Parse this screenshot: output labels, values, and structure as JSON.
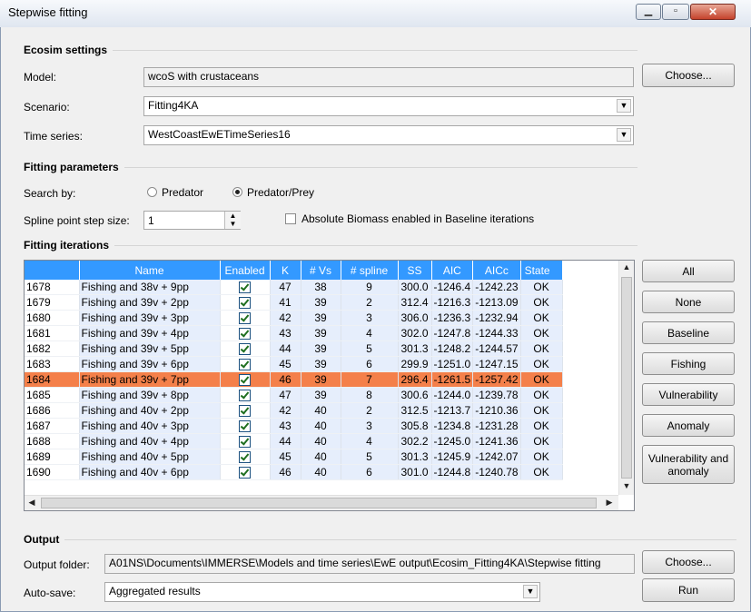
{
  "window": {
    "title": "Stepwise fitting"
  },
  "ecosim_settings": {
    "section_label": "Ecosim settings",
    "model_label": "Model:",
    "model_value": "wcoS with crustaceans",
    "choose_label": "Choose...",
    "scenario_label": "Scenario:",
    "scenario_value": "Fitting4KA",
    "time_series_label": "Time series:",
    "time_series_value": "WestCoastEwETimeSeries16"
  },
  "fitting_parameters": {
    "section_label": "Fitting parameters",
    "search_by_label": "Search by:",
    "predator_label": "Predator",
    "predator_prey_label": "Predator/Prey",
    "selected": "Predator/Prey",
    "spline_label": "Spline point step size:",
    "spline_value": "1",
    "absolute_biomass_label": "Absolute Biomass enabled in Baseline iterations",
    "absolute_biomass_checked": false
  },
  "fitting_iterations": {
    "section_label": "Fitting iterations",
    "columns": [
      "",
      "Name",
      "Enabled",
      "K",
      "# Vs",
      "# spline",
      "SS",
      "AIC",
      "AICc",
      "State"
    ],
    "selected_row_id": "1684",
    "rows": [
      {
        "id": "1678",
        "name": "Fishing and 38v + 9pp",
        "enabled": true,
        "k": "47",
        "vs": "38",
        "spline": "9",
        "ss": "300.0",
        "aic": "-1246.4",
        "aicc": "-1242.23",
        "state": "OK"
      },
      {
        "id": "1679",
        "name": "Fishing and 39v + 2pp",
        "enabled": true,
        "k": "41",
        "vs": "39",
        "spline": "2",
        "ss": "312.4",
        "aic": "-1216.3",
        "aicc": "-1213.09",
        "state": "OK"
      },
      {
        "id": "1680",
        "name": "Fishing and 39v + 3pp",
        "enabled": true,
        "k": "42",
        "vs": "39",
        "spline": "3",
        "ss": "306.0",
        "aic": "-1236.3",
        "aicc": "-1232.94",
        "state": "OK"
      },
      {
        "id": "1681",
        "name": "Fishing and 39v + 4pp",
        "enabled": true,
        "k": "43",
        "vs": "39",
        "spline": "4",
        "ss": "302.0",
        "aic": "-1247.8",
        "aicc": "-1244.33",
        "state": "OK"
      },
      {
        "id": "1682",
        "name": "Fishing and 39v + 5pp",
        "enabled": true,
        "k": "44",
        "vs": "39",
        "spline": "5",
        "ss": "301.3",
        "aic": "-1248.2",
        "aicc": "-1244.57",
        "state": "OK"
      },
      {
        "id": "1683",
        "name": "Fishing and 39v + 6pp",
        "enabled": true,
        "k": "45",
        "vs": "39",
        "spline": "6",
        "ss": "299.9",
        "aic": "-1251.0",
        "aicc": "-1247.15",
        "state": "OK"
      },
      {
        "id": "1684",
        "name": "Fishing and 39v + 7pp",
        "enabled": true,
        "k": "46",
        "vs": "39",
        "spline": "7",
        "ss": "296.4",
        "aic": "-1261.5",
        "aicc": "-1257.42",
        "state": "OK"
      },
      {
        "id": "1685",
        "name": "Fishing and 39v + 8pp",
        "enabled": true,
        "k": "47",
        "vs": "39",
        "spline": "8",
        "ss": "300.6",
        "aic": "-1244.0",
        "aicc": "-1239.78",
        "state": "OK"
      },
      {
        "id": "1686",
        "name": "Fishing and 40v + 2pp",
        "enabled": true,
        "k": "42",
        "vs": "40",
        "spline": "2",
        "ss": "312.5",
        "aic": "-1213.7",
        "aicc": "-1210.36",
        "state": "OK"
      },
      {
        "id": "1687",
        "name": "Fishing and 40v + 3pp",
        "enabled": true,
        "k": "43",
        "vs": "40",
        "spline": "3",
        "ss": "305.8",
        "aic": "-1234.8",
        "aicc": "-1231.28",
        "state": "OK"
      },
      {
        "id": "1688",
        "name": "Fishing and 40v + 4pp",
        "enabled": true,
        "k": "44",
        "vs": "40",
        "spline": "4",
        "ss": "302.2",
        "aic": "-1245.0",
        "aicc": "-1241.36",
        "state": "OK"
      },
      {
        "id": "1689",
        "name": "Fishing and 40v + 5pp",
        "enabled": true,
        "k": "45",
        "vs": "40",
        "spline": "5",
        "ss": "301.3",
        "aic": "-1245.9",
        "aicc": "-1242.07",
        "state": "OK"
      },
      {
        "id": "1690",
        "name": "Fishing and 40v + 6pp",
        "enabled": true,
        "k": "46",
        "vs": "40",
        "spline": "6",
        "ss": "301.0",
        "aic": "-1244.8",
        "aicc": "-1240.78",
        "state": "OK"
      }
    ]
  },
  "side_buttons": {
    "all": "All",
    "none": "None",
    "baseline": "Baseline",
    "fishing": "Fishing",
    "vulnerability": "Vulnerability",
    "anomaly": "Anomaly",
    "vuln_anomaly": "Vulnerability and anomaly"
  },
  "output": {
    "section_label": "Output",
    "folder_label": "Output folder:",
    "folder_value": "A01NS\\Documents\\IMMERSE\\Models and time series\\EwE output\\Ecosim_Fitting4KA\\Stepwise fitting",
    "choose_label": "Choose...",
    "autosave_label": "Auto-save:",
    "autosave_value": "Aggregated results",
    "run_label": "Run"
  },
  "colors": {
    "header": "#3399ff",
    "selected_row": "#f4804a",
    "row_tint": "#e6eefc"
  }
}
